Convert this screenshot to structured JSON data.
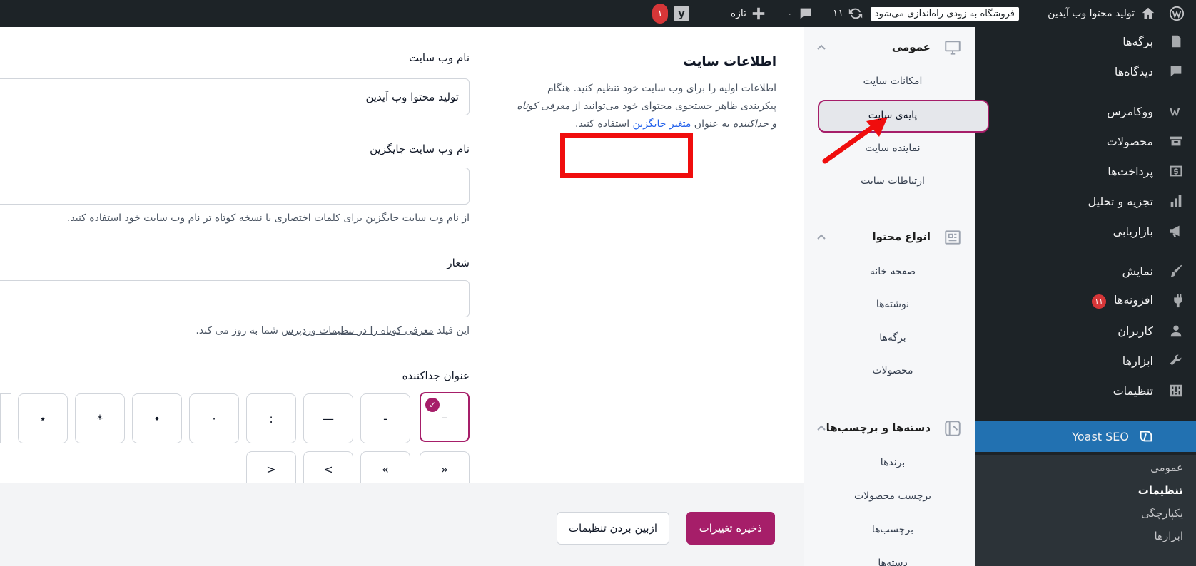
{
  "adminbar": {
    "site_name": "تولید محتوا وب آیدین",
    "store_notice": "فروشگاه به زودی راه‌اندازی می‌شود",
    "updates_count": "۱۱",
    "comments_count": "۰",
    "new_label": "تازه",
    "yoast_count": "۱"
  },
  "adminmenu": {
    "items": [
      {
        "label": "برگه‌ها"
      },
      {
        "label": "دیدگاه‌ها"
      },
      {
        "label": "ووکامرس"
      },
      {
        "label": "محصولات"
      },
      {
        "label": "پرداخت‌ها"
      },
      {
        "label": "تجزیه و تحلیل"
      },
      {
        "label": "بازاریابی"
      },
      {
        "label": "نمایش"
      },
      {
        "label": "افزونه‌ها",
        "badge": "۱۱"
      },
      {
        "label": "کاربران"
      },
      {
        "label": "ابزارها"
      },
      {
        "label": "تنظیمات"
      }
    ],
    "yoast_label": "Yoast SEO",
    "yoast_sub": [
      "عمومی",
      "تنظیمات",
      "یکپارچگی",
      "ابزارها"
    ]
  },
  "yoast_nav": {
    "groups": [
      {
        "label": "عمومی",
        "links": [
          "امکانات سایت",
          "پایه‌ی سایت",
          "نماینده سایت",
          "ارتباطات سایت"
        ]
      },
      {
        "label": "انواع محتوا",
        "links": [
          "صفحه خانه",
          "نوشته‌ها",
          "برگه‌ها",
          "محصولات"
        ]
      },
      {
        "label": "دسته‌ها و برچسب‌ها",
        "links": [
          "برندها",
          "برچسب محصولات",
          "برچسب‌ها",
          "دسته‌ها"
        ]
      }
    ]
  },
  "section": {
    "title": "اطلاعات سایت",
    "desc_1": "اطلاعات اولیه را برای وب سایت خود تنظیم کنید. هنگام پیکربندی ظاهر جستجوی محتوای خود می‌توانید از",
    "desc_em": "معرفی کوتاه",
    "desc_2": "و",
    "desc_em2": "جداکننده",
    "desc_3": "به عنوان",
    "desc_link": "متغیر جایگزین",
    "desc_4": "استفاده کنید."
  },
  "fields": {
    "site_name_label": "نام وب سایت",
    "site_name_value": "تولید محتوا وب آیدین",
    "alt_name_label": "نام وب سایت جایگزین",
    "alt_name_value": "",
    "alt_name_help": "از نام وب سایت جایگزین برای کلمات اختصاری یا نسخه کوتاه تر نام وب سایت خود استفاده کنید.",
    "tagline_label": "شعار",
    "tagline_value": "",
    "tagline_help_1": "این فیلد",
    "tagline_help_link": "معرفی کوتاه را در تنظیمات وردپرس",
    "tagline_help_2": "شما به روز می کند.",
    "separator_label": "عنوان جداکننده",
    "separators_row1": [
      "–",
      "-",
      "—",
      ":",
      "·",
      "•",
      "*",
      "⋆"
    ],
    "separators_row2": [
      "«",
      "»",
      ">",
      "<"
    ]
  },
  "footer": {
    "save_label": "ذخیره تغییرات",
    "discard_label": "ازبین بردن تنظیمات"
  }
}
